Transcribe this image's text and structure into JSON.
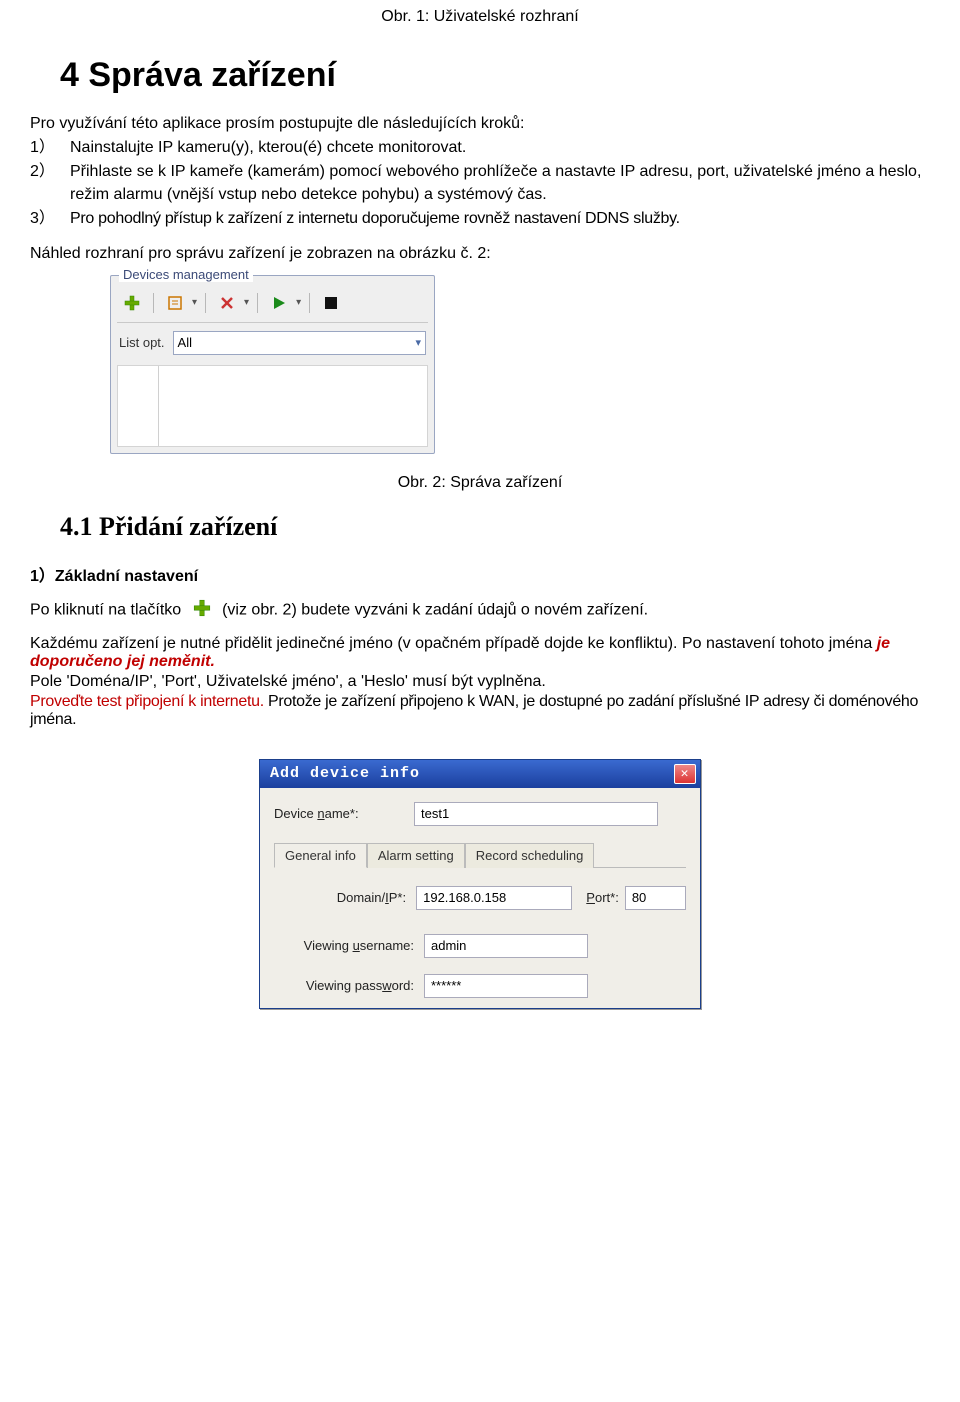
{
  "caption1": "Obr. 1: Uživatelské rozhraní",
  "h1": "4 Správa zařízení",
  "intro": "Pro využívání této aplikace prosím postupujte dle následujících kroků:",
  "steps": {
    "s1_num": "1）",
    "s1": "Nainstalujte IP kameru(y), kterou(é) chcete monitorovat.",
    "s2_num": "2）",
    "s2": "Přihlaste se k IP kameře (kamerám) pomocí webového prohlížeče a nastavte IP adresu, port, uživatelské jméno a heslo, režim alarmu (vnější vstup nebo detekce pohybu) a systémový čas.",
    "s3_num": "3）",
    "s3": "Pro pohodlný přístup k zařízení z internetu doporučujeme rovněž nastavení DDNS služby."
  },
  "para_preview": "Náhled rozhraní pro správu zařízení je zobrazen na obrázku č. 2:",
  "devmgmt": {
    "legend": "Devices management",
    "filter_label": "List opt.",
    "filter_value": "All"
  },
  "caption2": "Obr. 2: Správa zařízení",
  "h2": "4.1 Přidání zařízení",
  "sub_heading": "1）Základní nastavení",
  "para_click_before": "Po kliknutí na tlačítko",
  "para_click_after": "(viz obr. 2) budete vyzváni k zadání údajů o novém zařízení.",
  "para_unique": "Každému zařízení je nutné přidělit jedinečné jméno (v opačném případě dojde ke konfliktu). Po nastavení tohoto jména ",
  "para_unique_red": "je doporučeno jej neměnit.",
  "para_fields": "Pole 'Doména/IP', 'Port', Uživatelské jméno', a 'Heslo' musí být vyplněna.",
  "para_test_red": "Proveďte test připojení k internetu.",
  "para_test_rest": " Protože je zařízení připojeno k WAN, je dostupné po zadání příslušné IP adresy či doménového jména.",
  "dialog": {
    "title": "Add device info",
    "device_name_label": "Device name*:",
    "device_name_value": "test1",
    "tabs": {
      "t1": "General info",
      "t2": "Alarm setting",
      "t3": "Record scheduling"
    },
    "domain_label": "Domain/IP*:",
    "domain_value": "192.168.0.158",
    "port_label": "Port*:",
    "port_value": "80",
    "user_label": "Viewing username:",
    "user_value": "admin",
    "pass_label": "Viewing password:",
    "pass_value": "******"
  }
}
